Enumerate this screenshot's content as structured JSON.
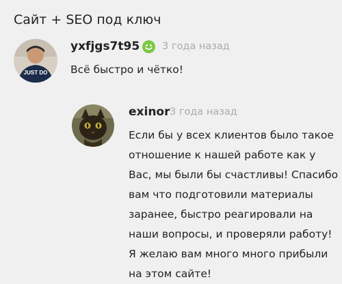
{
  "page": {
    "title": "Сайт + SEO под ключ"
  },
  "review": {
    "username": "yxfjgs7t95",
    "rating_icon": "smile-face-icon",
    "time": "3 года назад",
    "text": "Всё быстро и чётко!",
    "avatar_shirt_text": "JUST DO"
  },
  "reply": {
    "username": "exinor",
    "time": "3 года назад",
    "text": "Если бы у всех клиентов было такое\nотношение к нашей работе как у\nВас, мы были бы счастливы! Спасибо\nвам что подготовили материалы\nзаранее, быстро реагировали на\nнаши вопросы, и проверяли работу!\nЯ желаю вам много много прибыли\nна этом сайте!"
  },
  "colors": {
    "positive": "#7ac943",
    "muted": "#aaaaaa",
    "background": "#f0f0f0"
  }
}
